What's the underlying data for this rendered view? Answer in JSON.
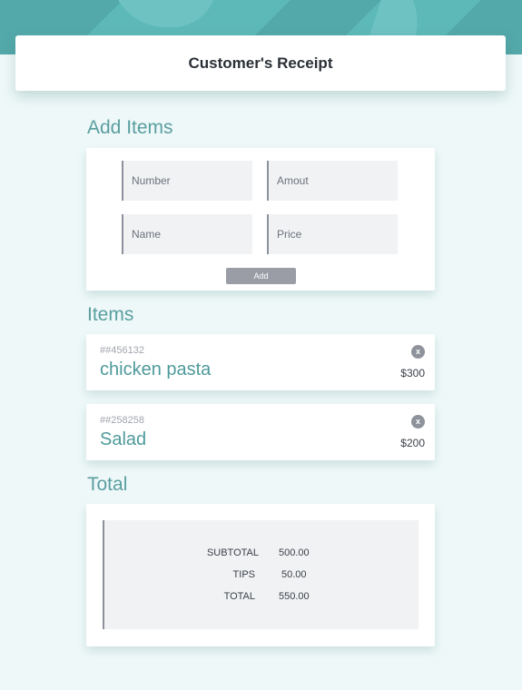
{
  "header": {
    "title": "Customer's Receipt"
  },
  "add_items": {
    "title": "Add Items",
    "number_placeholder": "Number",
    "amount_placeholder": "Amout",
    "name_placeholder": "Name",
    "price_placeholder": "Price",
    "add_label": "Add"
  },
  "items": {
    "title": "Items",
    "list": [
      {
        "code": "##456132",
        "name": "chicken pasta",
        "price": "$300",
        "remove_glyph": "x"
      },
      {
        "code": "##258258",
        "name": "Salad",
        "price": "$200",
        "remove_glyph": "x"
      }
    ]
  },
  "total": {
    "title": "Total",
    "rows": [
      {
        "label": "SUBTOTAL",
        "value": "500.00"
      },
      {
        "label": "TIPS",
        "value": "50.00"
      },
      {
        "label": "TOTAL",
        "value": "550.00"
      }
    ]
  },
  "colors": {
    "banner": "#5db8b8",
    "page_background": "#eef8f8",
    "accent_text": "#5a9ea0",
    "button": "#9a9ca6"
  },
  "icons": {
    "remove": "close-icon"
  }
}
